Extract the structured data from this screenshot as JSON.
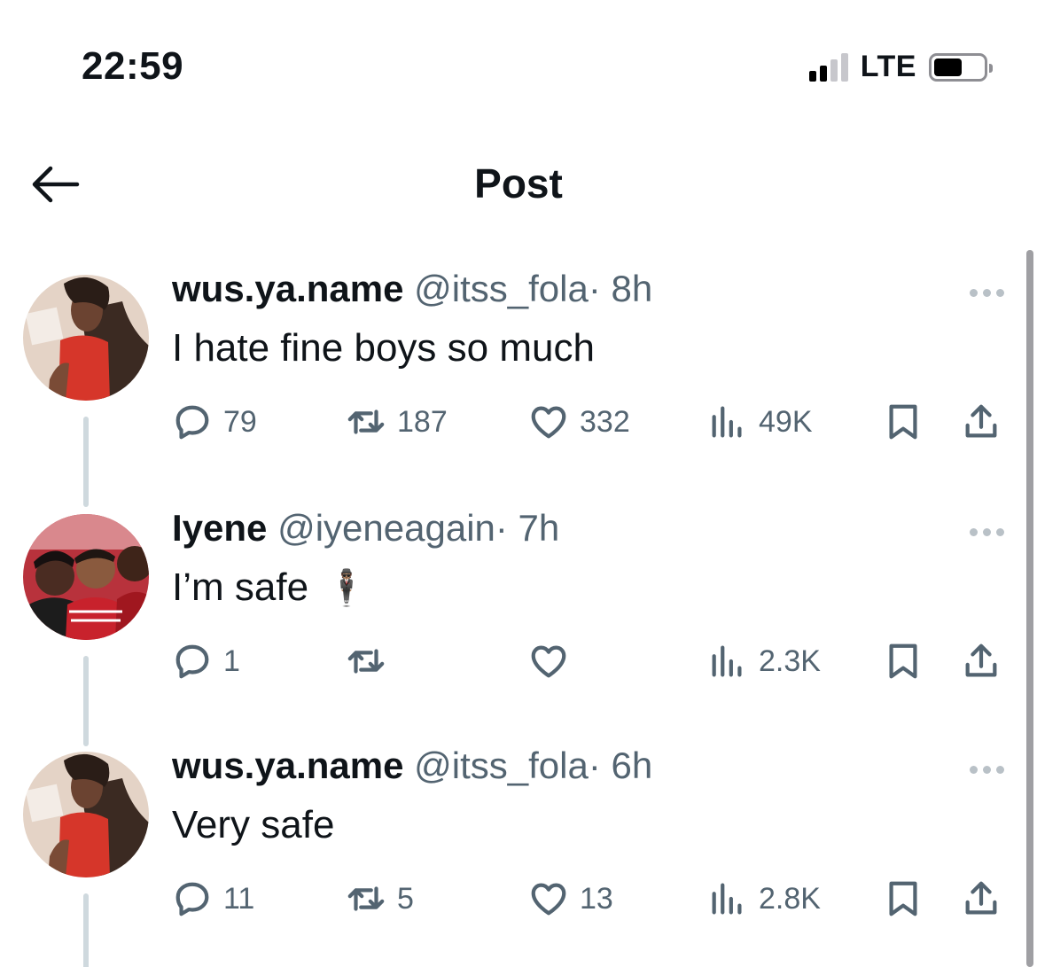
{
  "status_bar": {
    "time": "22:59",
    "network": "LTE"
  },
  "header": {
    "title": "Post"
  },
  "posts": [
    {
      "name": "wus.ya.name",
      "handle": "@itss_fola",
      "time": "· 8h",
      "text": "I hate fine boys so much",
      "emoji": "",
      "replies": "79",
      "reposts": "187",
      "likes": "332",
      "views": "49K"
    },
    {
      "name": "Iyene",
      "handle": "@iyeneagain",
      "time": "· 7h",
      "text": "I’m safe",
      "emoji": "🕴🏽",
      "replies": "1",
      "reposts": "",
      "likes": "",
      "views": "2.3K"
    },
    {
      "name": "wus.ya.name",
      "handle": "@itss_fola",
      "time": "· 6h",
      "text": "Very safe",
      "emoji": "",
      "replies": "11",
      "reposts": "5",
      "likes": "13",
      "views": "2.8K"
    }
  ],
  "colors": {
    "text_primary": "#0f1419",
    "text_secondary": "#536471",
    "thread_line": "#cfd9de"
  }
}
